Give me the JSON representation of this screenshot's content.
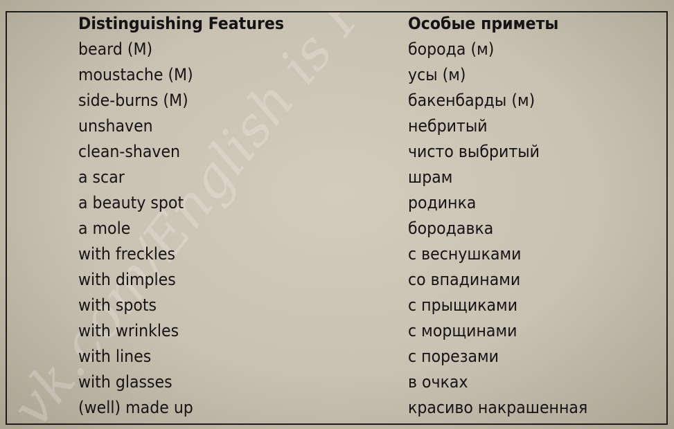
{
  "watermark": "vk.com/English is Fun",
  "headers": {
    "english": "Distinguishing Features",
    "russian": "Особые приметы"
  },
  "rows": [
    {
      "en": "beard (M)",
      "ru": "борода (м)"
    },
    {
      "en": "moustache (M)",
      "ru": "усы (м)"
    },
    {
      "en": "side-burns (M)",
      "ru": "бакенбарды (м)"
    },
    {
      "en": "unshaven",
      "ru": "небритый"
    },
    {
      "en": "clean-shaven",
      "ru": "чисто выбритый"
    },
    {
      "en": "a scar",
      "ru": "шрам"
    },
    {
      "en": "a beauty spot",
      "ru": "родинка"
    },
    {
      "en": "a mole",
      "ru": "бородавка"
    },
    {
      "en": "with freckles",
      "ru": "с веснушками"
    },
    {
      "en": "with dimples",
      "ru": "со впадинами"
    },
    {
      "en": "with spots",
      "ru": "с прыщиками"
    },
    {
      "en": "with wrinkles",
      "ru": "с морщинами"
    },
    {
      "en": "with lines",
      "ru": "с порезами"
    },
    {
      "en": "with glasses",
      "ru": "в очках"
    },
    {
      "en": "(well) made up",
      "ru": "красиво накрашенная"
    }
  ]
}
